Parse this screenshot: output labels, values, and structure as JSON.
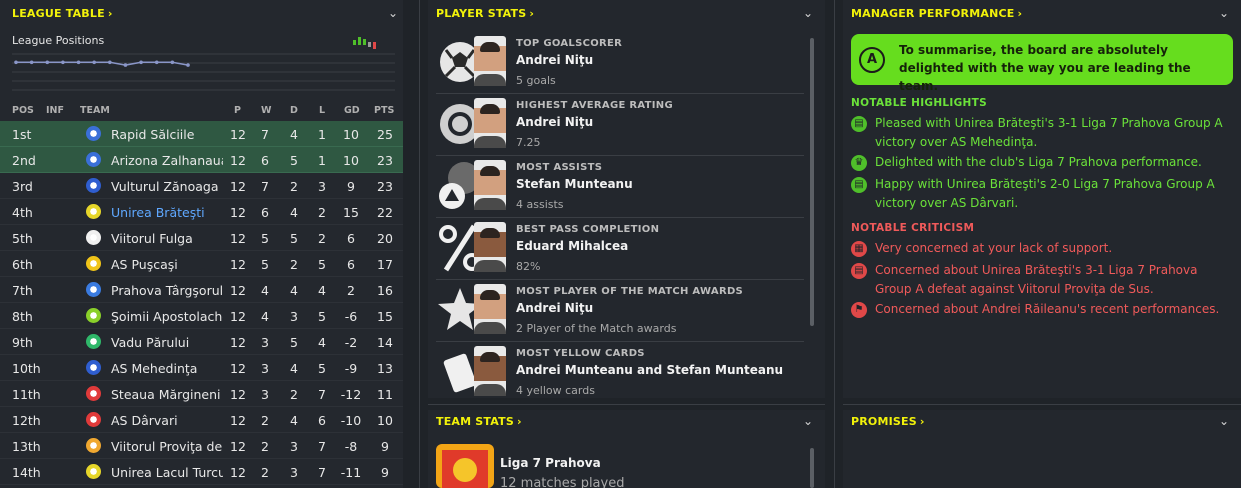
{
  "league_table": {
    "title": "LEAGUE TABLE",
    "positions_label": "League Positions",
    "columns": {
      "pos": "POS",
      "inf": "INF",
      "team": "TEAM",
      "p": "P",
      "w": "W",
      "d": "D",
      "l": "L",
      "gd": "GD",
      "pts": "PTS"
    },
    "rows": [
      {
        "pos": "1st",
        "team": "Rapid Sălciile",
        "p": "12",
        "w": "7",
        "d": "4",
        "l": "1",
        "gd": "10",
        "pts": "25",
        "crest": "#3a6fd8"
      },
      {
        "pos": "2nd",
        "team": "Arizona Zalhanaua",
        "p": "12",
        "w": "6",
        "d": "5",
        "l": "1",
        "gd": "10",
        "pts": "23",
        "crest": "#3a6fd8"
      },
      {
        "pos": "3rd",
        "team": "Vulturul Zănoaga",
        "p": "12",
        "w": "7",
        "d": "2",
        "l": "3",
        "gd": "9",
        "pts": "23",
        "crest": "#2f5ed0"
      },
      {
        "pos": "4th",
        "team": "Unirea Brăteşti",
        "p": "12",
        "w": "6",
        "d": "4",
        "l": "2",
        "gd": "15",
        "pts": "22",
        "crest": "#e6d62a"
      },
      {
        "pos": "5th",
        "team": "Viitorul Fulga",
        "p": "12",
        "w": "5",
        "d": "5",
        "l": "2",
        "gd": "6",
        "pts": "20",
        "crest": "#f0f0f0"
      },
      {
        "pos": "6th",
        "team": "AS Puşcaşi",
        "p": "12",
        "w": "5",
        "d": "2",
        "l": "5",
        "gd": "6",
        "pts": "17",
        "crest": "#f0c419"
      },
      {
        "pos": "7th",
        "team": "Prahova Târgşorul Vechi",
        "p": "12",
        "w": "4",
        "d": "4",
        "l": "4",
        "gd": "2",
        "pts": "16",
        "crest": "#3a7be0"
      },
      {
        "pos": "8th",
        "team": "Şoimii Apostolache",
        "p": "12",
        "w": "4",
        "d": "3",
        "l": "5",
        "gd": "-6",
        "pts": "15",
        "crest": "#8ad02a"
      },
      {
        "pos": "9th",
        "team": "Vadu Părului",
        "p": "12",
        "w": "3",
        "d": "5",
        "l": "4",
        "gd": "-2",
        "pts": "14",
        "crest": "#2fb86a"
      },
      {
        "pos": "10th",
        "team": "AS Mehedinţa",
        "p": "12",
        "w": "3",
        "d": "4",
        "l": "5",
        "gd": "-9",
        "pts": "13",
        "crest": "#2f5ed0"
      },
      {
        "pos": "11th",
        "team": "Steaua Mărgineni",
        "p": "12",
        "w": "3",
        "d": "2",
        "l": "7",
        "gd": "-12",
        "pts": "11",
        "crest": "#e03a3a"
      },
      {
        "pos": "12th",
        "team": "AS Dârvari",
        "p": "12",
        "w": "2",
        "d": "4",
        "l": "6",
        "gd": "-10",
        "pts": "10",
        "crest": "#e03a3a"
      },
      {
        "pos": "13th",
        "team": "Viitorul Proviţa de Sus",
        "p": "12",
        "w": "2",
        "d": "3",
        "l": "7",
        "gd": "-8",
        "pts": "9",
        "crest": "#f0a830"
      },
      {
        "pos": "14th",
        "team": "Unirea Lacul Turcului",
        "p": "12",
        "w": "2",
        "d": "3",
        "l": "7",
        "gd": "-11",
        "pts": "9",
        "crest": "#e6d62a"
      }
    ]
  },
  "player_stats": {
    "title": "PLAYER STATS",
    "items": [
      {
        "title": "TOP GOALSCORER",
        "name": "Andrei Niţu",
        "value": "5 goals",
        "icon": "football-icon"
      },
      {
        "title": "HIGHEST AVERAGE RATING",
        "name": "Andrei Niţu",
        "value": "7.25",
        "icon": "rating-medal-icon"
      },
      {
        "title": "MOST ASSISTS",
        "name": "Stefan Munteanu",
        "value": "4 assists",
        "icon": "assist-icon"
      },
      {
        "title": "BEST PASS COMPLETION",
        "name": "Eduard Mihalcea",
        "value": "82%",
        "icon": "percent-icon"
      },
      {
        "title": "MOST PLAYER OF THE MATCH AWARDS",
        "name": "Andrei Niţu",
        "value": "2 Player of the Match awards",
        "icon": "star-icon"
      },
      {
        "title": "MOST YELLOW CARDS",
        "name": "Andrei Munteanu and Stefan Munteanu",
        "value": "4 yellow cards",
        "icon": "card-icon"
      }
    ]
  },
  "manager_performance": {
    "title": "MANAGER PERFORMANCE",
    "grade": "A",
    "summary": "To summarise, the board are absolutely delighted with the way you are leading the team.",
    "highlights_title": "NOTABLE HIGHLIGHTS",
    "highlights": [
      "Pleased with Unirea Brăteşti's 3-1 Liga 7 Prahova Group A victory over AS Mehedinţa.",
      "Delighted with the club's Liga 7 Prahova performance.",
      "Happy with Unirea Brăteşti's 2-0 Liga 7 Prahova Group A victory over AS Dârvari."
    ],
    "criticism_title": "NOTABLE CRITICISM",
    "criticism": [
      "Very concerned at your lack of support.",
      "Concerned about Unirea Brăteşti's 3-1 Liga 7 Prahova Group A defeat against Viitorul Proviţa de Sus.",
      "Concerned about Andrei Răileanu's recent performances."
    ]
  },
  "team_stats": {
    "title": "TEAM STATS",
    "competition": "Liga 7 Prahova",
    "matches": "12 matches played"
  },
  "promises": {
    "title": "PROMISES"
  },
  "league_positions_chart": {
    "type": "line",
    "values": [
      4,
      4,
      4,
      4,
      4,
      4,
      4,
      5,
      4,
      4,
      4,
      5
    ],
    "ylim": [
      1,
      14
    ]
  }
}
